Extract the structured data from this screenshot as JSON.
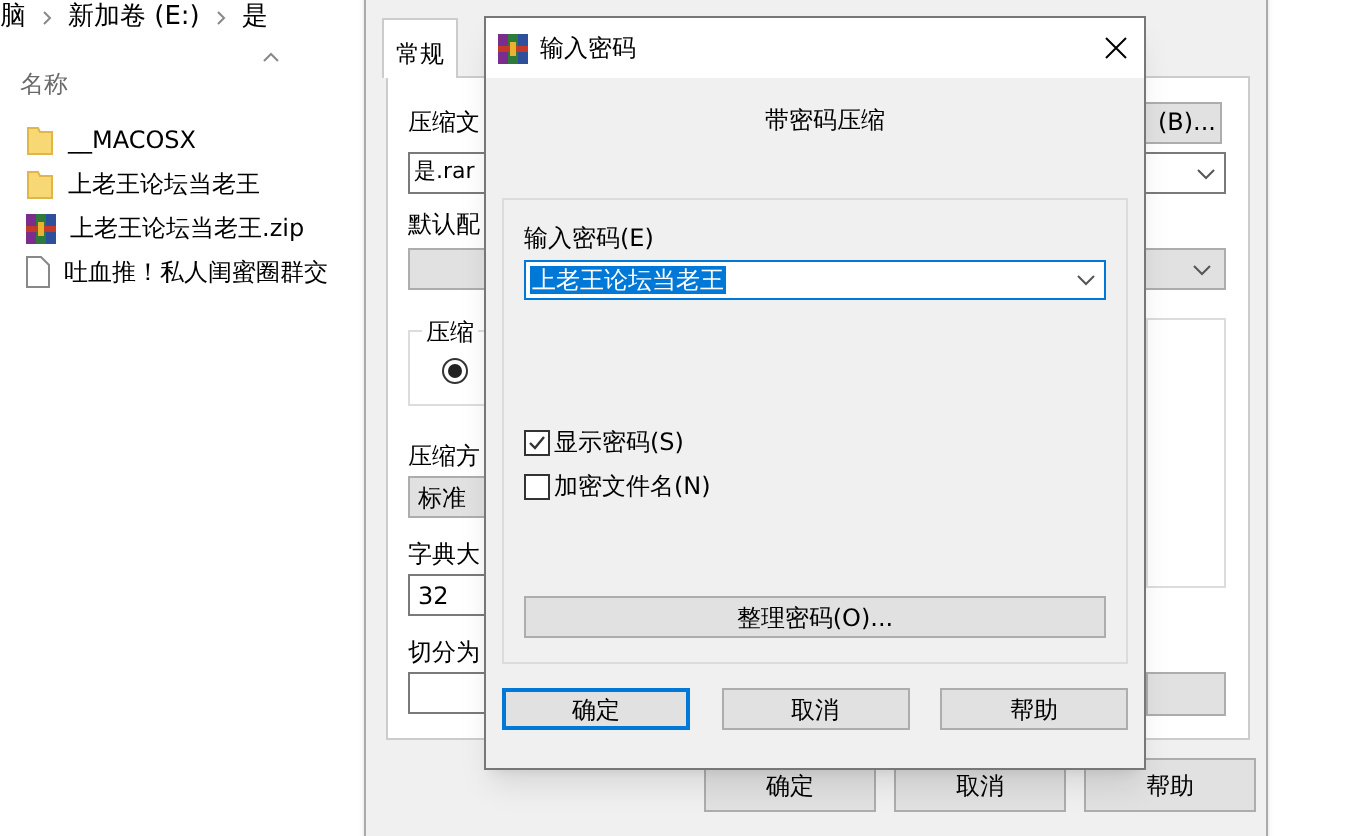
{
  "explorer": {
    "breadcrumb": [
      "脑",
      "新加卷 (E:)",
      "是"
    ],
    "column_header": "名称",
    "files": [
      {
        "name": "__MACOSX",
        "kind": "folder"
      },
      {
        "name": "上老王论坛当老王",
        "kind": "folder"
      },
      {
        "name": "上老王论坛当老王.zip",
        "kind": "archive"
      },
      {
        "name": "吐血推！私人闺蜜圈群交",
        "kind": "file"
      }
    ]
  },
  "archive_dialog": {
    "tabs": [
      {
        "label": "常规",
        "selected": true
      }
    ],
    "archive_name_label": "压缩文",
    "browse_button": "(B)...",
    "archive_name": "是.rar",
    "profile_label": "默认配",
    "format_group": "压缩",
    "format_radio_selected": true,
    "method_label": "压缩方",
    "method": "标准",
    "dictionary_label": "字典大",
    "dictionary": "32",
    "split_label": "切分为",
    "buttons": [
      "确定",
      "取消",
      "帮助"
    ]
  },
  "password_dialog": {
    "title": "输入密码",
    "heading": "带密码压缩",
    "password_label": "输入密码(E)",
    "password": "上老王论坛当老王",
    "options": [
      {
        "label": "显示密码(S)",
        "checked": true
      },
      {
        "label": "加密文件名(N)",
        "checked": false
      }
    ],
    "organize_button": "整理密码(O)...",
    "buttons": [
      {
        "label": "确定",
        "default": true
      },
      {
        "label": "取消",
        "default": false
      },
      {
        "label": "帮助",
        "default": false
      }
    ]
  }
}
